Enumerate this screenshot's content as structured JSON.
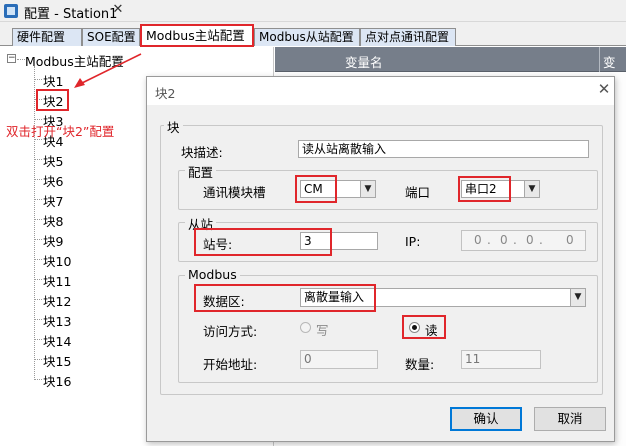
{
  "window": {
    "title": "配置 - Station1",
    "close_glyph": "✕"
  },
  "tabs": [
    {
      "label": "硬件配置"
    },
    {
      "label": "SOE配置"
    },
    {
      "label": "Modbus主站配置"
    },
    {
      "label": "Modbus从站配置"
    },
    {
      "label": "点对点通讯配置"
    }
  ],
  "tree": {
    "toggle": "−",
    "root": "Modbus主站配置",
    "items": [
      "块1",
      "块2",
      "块3",
      "块4",
      "块5",
      "块6",
      "块7",
      "块8",
      "块9",
      "块10",
      "块11",
      "块12",
      "块13",
      "块14",
      "块15",
      "块16"
    ]
  },
  "annotation": "双击打开“块2”配置",
  "grid": {
    "columns": [
      "变量名",
      "变量"
    ]
  },
  "dialog": {
    "title": "块2",
    "close_glyph": "✕",
    "group_block": "块",
    "desc_label": "块描述:",
    "desc_value": "读从站离散输入",
    "group_config": "配置",
    "slot_label": "通讯模块槽",
    "slot_value": "CM",
    "port_label": "端口",
    "port_value": "串口2",
    "group_slave": "从站",
    "station_label": "站号:",
    "station_value": "3",
    "ip_label": "IP:",
    "ip_parts": [
      "0",
      "0",
      "0",
      "0"
    ],
    "ip_dots": [
      ".",
      ".",
      "."
    ],
    "group_modbus": "Modbus",
    "data_area_label": "数据区:",
    "data_area_value": "离散量输入",
    "access_label": "访问方式:",
    "access_write": "写",
    "access_read": "读",
    "start_label": "开始地址:",
    "start_value": "0",
    "count_label": "数量:",
    "count_value": "11",
    "ok": "确认",
    "cancel": "取消",
    "dropdown_glyph": "▼"
  },
  "colors": {
    "highlight": "#e0262b",
    "tab_inactive": "#dce6f4",
    "grid_header": "#767e8a",
    "accent": "#0078d7"
  },
  "icons": {
    "app": "app-icon",
    "close": "close-icon",
    "dropdown": "chevron-down-icon",
    "arrow": "annotation-arrow"
  }
}
